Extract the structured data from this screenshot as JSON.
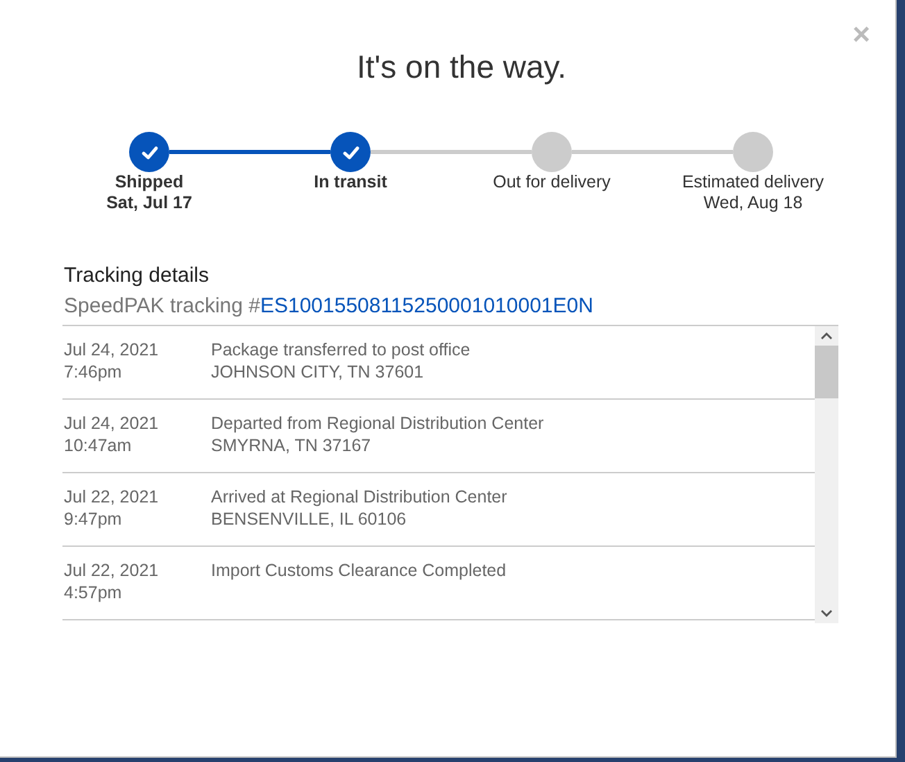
{
  "dialog": {
    "title": "It's on the way.",
    "close": "×"
  },
  "steps": [
    {
      "label": "Shipped",
      "date": "Sat, Jul 17",
      "completed": true
    },
    {
      "label": "In transit",
      "completed": true
    },
    {
      "label": "Out for delivery",
      "completed": false
    },
    {
      "label": "Estimated delivery",
      "date": "Wed, Aug 18",
      "completed": false
    }
  ],
  "tracking": {
    "heading": "Tracking details",
    "carrier_label": "SpeedPAK tracking #",
    "number": "ES10015508115250001010001E0N"
  },
  "events": [
    {
      "date": "Jul 24, 2021",
      "time": "7:46pm",
      "description": "Package transferred to post office",
      "location": "JOHNSON CITY, TN 37601"
    },
    {
      "date": "Jul 24, 2021",
      "time": "10:47am",
      "description": "Departed from Regional Distribution Center",
      "location": "SMYRNA, TN 37167"
    },
    {
      "date": "Jul 22, 2021",
      "time": "9:47pm",
      "description": "Arrived at Regional Distribution Center",
      "location": "BENSENVILLE, IL 60106"
    },
    {
      "date": "Jul 22, 2021",
      "time": "4:57pm",
      "description": "Import Customs Clearance Completed"
    }
  ]
}
